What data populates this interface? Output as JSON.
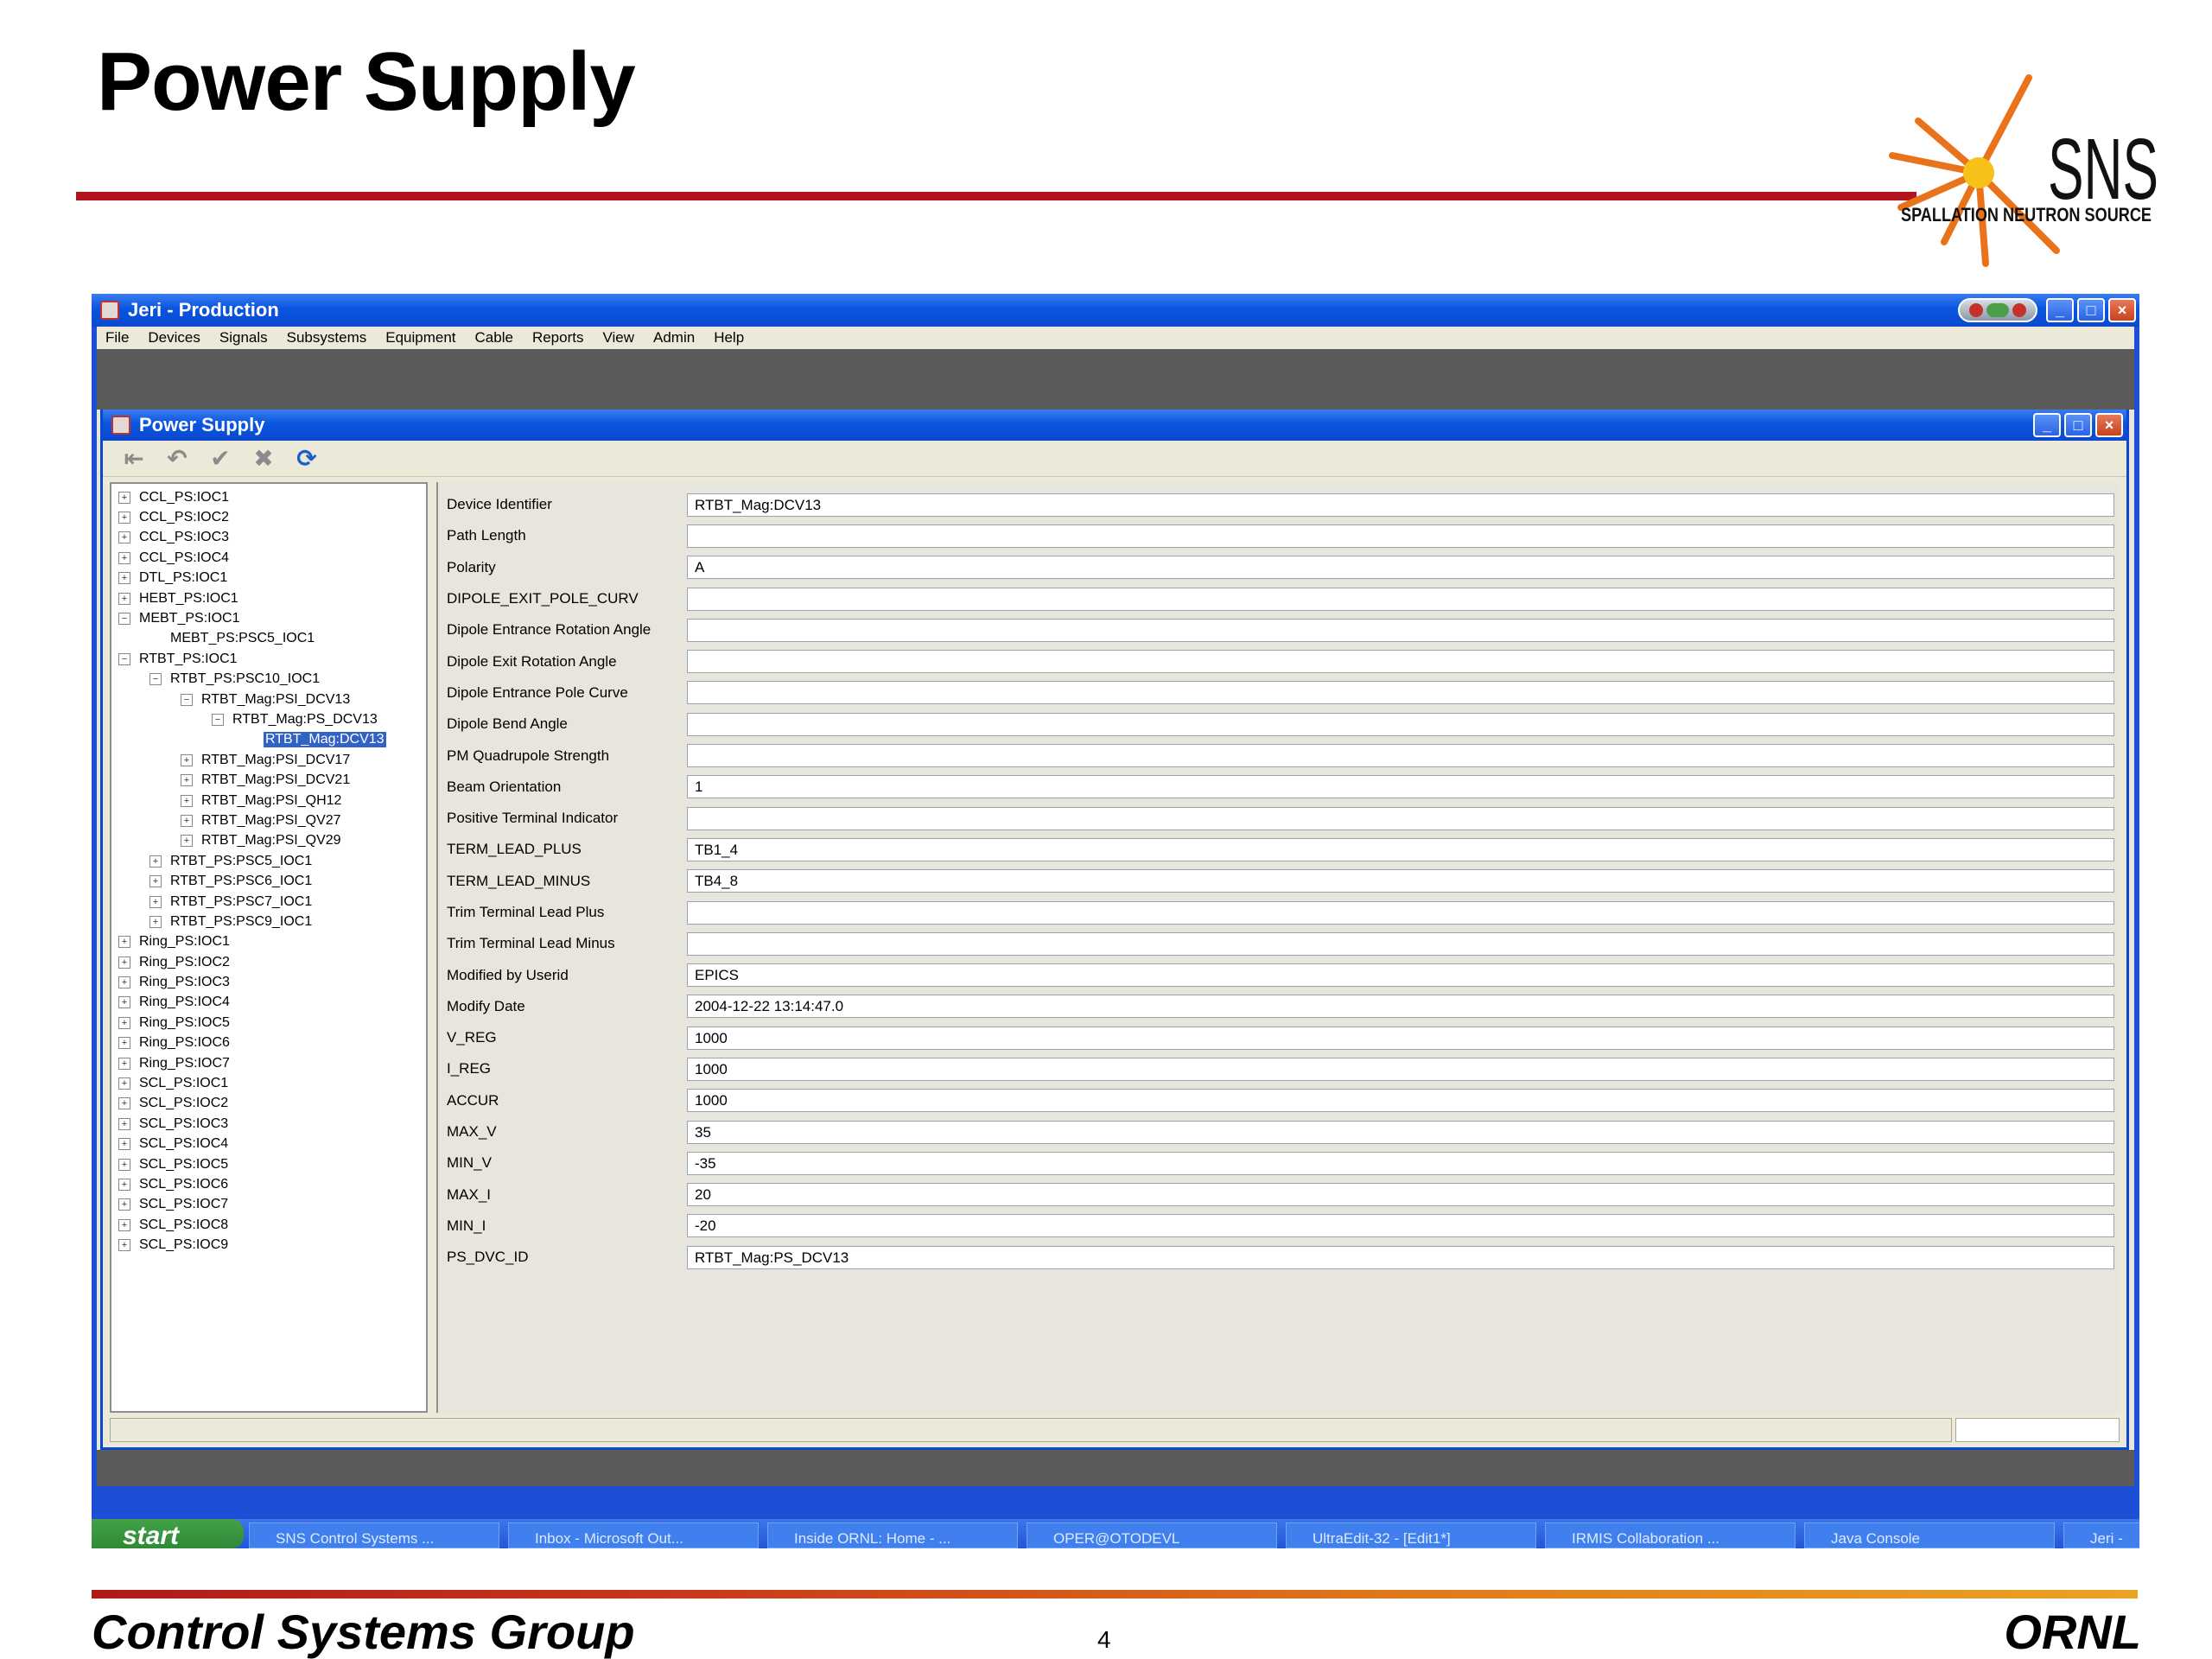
{
  "slide": {
    "title": "Power Supply",
    "footer_left": "Control Systems Group",
    "footer_page": "4",
    "footer_right": "ORNL",
    "logo_text": "SNS",
    "logo_subtitle": "SPALLATION NEUTRON SOURCE"
  },
  "app": {
    "window_title": "Jeri - Production",
    "menu": [
      "File",
      "Devices",
      "Signals",
      "Subsystems",
      "Equipment",
      "Cable",
      "Reports",
      "View",
      "Admin",
      "Help"
    ],
    "inner_title": "Power Supply",
    "toolbar_icons": [
      "exit-icon",
      "undo-icon",
      "check-icon",
      "delete-icon",
      "refresh-icon"
    ]
  },
  "tree": [
    {
      "label": "CCL_PS:IOC1",
      "indent": 0,
      "toggle": "+"
    },
    {
      "label": "CCL_PS:IOC2",
      "indent": 0,
      "toggle": "+"
    },
    {
      "label": "CCL_PS:IOC3",
      "indent": 0,
      "toggle": "+"
    },
    {
      "label": "CCL_PS:IOC4",
      "indent": 0,
      "toggle": "+"
    },
    {
      "label": "DTL_PS:IOC1",
      "indent": 0,
      "toggle": "+"
    },
    {
      "label": "HEBT_PS:IOC1",
      "indent": 0,
      "toggle": "+"
    },
    {
      "label": "MEBT_PS:IOC1",
      "indent": 0,
      "toggle": "-"
    },
    {
      "label": "MEBT_PS:PSC5_IOC1",
      "indent": 1,
      "toggle": ""
    },
    {
      "label": "RTBT_PS:IOC1",
      "indent": 0,
      "toggle": "-"
    },
    {
      "label": "RTBT_PS:PSC10_IOC1",
      "indent": 1,
      "toggle": "-"
    },
    {
      "label": "RTBT_Mag:PSI_DCV13",
      "indent": 2,
      "toggle": "-"
    },
    {
      "label": "RTBT_Mag:PS_DCV13",
      "indent": 3,
      "toggle": "-"
    },
    {
      "label": "RTBT_Mag:DCV13",
      "indent": 4,
      "toggle": "",
      "selected": true
    },
    {
      "label": "RTBT_Mag:PSI_DCV17",
      "indent": 2,
      "toggle": "+"
    },
    {
      "label": "RTBT_Mag:PSI_DCV21",
      "indent": 2,
      "toggle": "+"
    },
    {
      "label": "RTBT_Mag:PSI_QH12",
      "indent": 2,
      "toggle": "+"
    },
    {
      "label": "RTBT_Mag:PSI_QV27",
      "indent": 2,
      "toggle": "+"
    },
    {
      "label": "RTBT_Mag:PSI_QV29",
      "indent": 2,
      "toggle": "+"
    },
    {
      "label": "RTBT_PS:PSC5_IOC1",
      "indent": 1,
      "toggle": "+"
    },
    {
      "label": "RTBT_PS:PSC6_IOC1",
      "indent": 1,
      "toggle": "+"
    },
    {
      "label": "RTBT_PS:PSC7_IOC1",
      "indent": 1,
      "toggle": "+"
    },
    {
      "label": "RTBT_PS:PSC9_IOC1",
      "indent": 1,
      "toggle": "+"
    },
    {
      "label": "Ring_PS:IOC1",
      "indent": 0,
      "toggle": "+"
    },
    {
      "label": "Ring_PS:IOC2",
      "indent": 0,
      "toggle": "+"
    },
    {
      "label": "Ring_PS:IOC3",
      "indent": 0,
      "toggle": "+"
    },
    {
      "label": "Ring_PS:IOC4",
      "indent": 0,
      "toggle": "+"
    },
    {
      "label": "Ring_PS:IOC5",
      "indent": 0,
      "toggle": "+"
    },
    {
      "label": "Ring_PS:IOC6",
      "indent": 0,
      "toggle": "+"
    },
    {
      "label": "Ring_PS:IOC7",
      "indent": 0,
      "toggle": "+"
    },
    {
      "label": "SCL_PS:IOC1",
      "indent": 0,
      "toggle": "+"
    },
    {
      "label": "SCL_PS:IOC2",
      "indent": 0,
      "toggle": "+"
    },
    {
      "label": "SCL_PS:IOC3",
      "indent": 0,
      "toggle": "+"
    },
    {
      "label": "SCL_PS:IOC4",
      "indent": 0,
      "toggle": "+"
    },
    {
      "label": "SCL_PS:IOC5",
      "indent": 0,
      "toggle": "+"
    },
    {
      "label": "SCL_PS:IOC6",
      "indent": 0,
      "toggle": "+"
    },
    {
      "label": "SCL_PS:IOC7",
      "indent": 0,
      "toggle": "+"
    },
    {
      "label": "SCL_PS:IOC8",
      "indent": 0,
      "toggle": "+"
    },
    {
      "label": "SCL_PS:IOC9",
      "indent": 0,
      "toggle": "+"
    }
  ],
  "fields": [
    {
      "label": "Device Identifier",
      "value": "RTBT_Mag:DCV13"
    },
    {
      "label": "Path Length",
      "value": ""
    },
    {
      "label": "Polarity",
      "value": "A"
    },
    {
      "label": "DIPOLE_EXIT_POLE_CURV",
      "value": ""
    },
    {
      "label": "Dipole Entrance Rotation Angle",
      "value": ""
    },
    {
      "label": "Dipole Exit Rotation Angle",
      "value": ""
    },
    {
      "label": "Dipole Entrance Pole Curve",
      "value": ""
    },
    {
      "label": "Dipole Bend Angle",
      "value": ""
    },
    {
      "label": "PM Quadrupole Strength",
      "value": ""
    },
    {
      "label": "Beam Orientation",
      "value": "1"
    },
    {
      "label": "Positive Terminal Indicator",
      "value": ""
    },
    {
      "label": "TERM_LEAD_PLUS",
      "value": "TB1_4"
    },
    {
      "label": "TERM_LEAD_MINUS",
      "value": "TB4_8"
    },
    {
      "label": "Trim Terminal Lead Plus",
      "value": ""
    },
    {
      "label": "Trim Terminal Lead Minus",
      "value": ""
    },
    {
      "label": "Modified by Userid",
      "value": "EPICS"
    },
    {
      "label": "Modify Date",
      "value": "2004-12-22 13:14:47.0"
    },
    {
      "label": "V_REG",
      "value": "1000"
    },
    {
      "label": "I_REG",
      "value": "1000"
    },
    {
      "label": "ACCUR",
      "value": "1000"
    },
    {
      "label": "MAX_V",
      "value": "35"
    },
    {
      "label": "MIN_V",
      "value": "-35"
    },
    {
      "label": "MAX_I",
      "value": "20"
    },
    {
      "label": "MIN_I",
      "value": "-20"
    },
    {
      "label": "PS_DVC_ID",
      "value": "RTBT_Mag:PS_DCV13"
    }
  ],
  "taskbar": {
    "start": "start",
    "tasks": [
      "SNS Control Systems ...",
      "Inbox - Microsoft Out...",
      "Inside ORNL: Home - ...",
      "OPER@OTODEVL",
      "UltraEdit-32 - [Edit1*]",
      "IRMIS Collaboration ...",
      "Java Console",
      "Jeri -"
    ]
  }
}
